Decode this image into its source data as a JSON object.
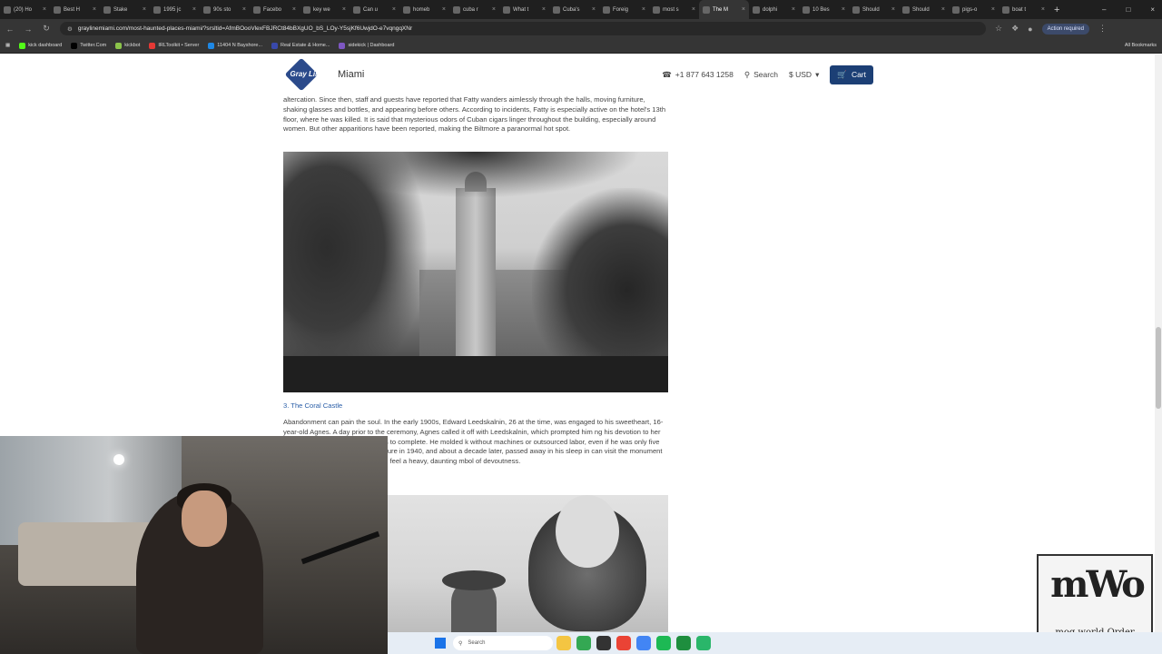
{
  "browser": {
    "tabs": [
      {
        "title": "(20) Ho",
        "active": false
      },
      {
        "title": "Best H",
        "active": false
      },
      {
        "title": "Stake",
        "active": false
      },
      {
        "title": "1995 jc",
        "active": false
      },
      {
        "title": "90s sto",
        "active": false
      },
      {
        "title": "Facebo",
        "active": false
      },
      {
        "title": "key we",
        "active": false
      },
      {
        "title": "Can u",
        "active": false
      },
      {
        "title": "homeb",
        "active": false
      },
      {
        "title": "cuba r",
        "active": false
      },
      {
        "title": "What t",
        "active": false
      },
      {
        "title": "Cuba's",
        "active": false
      },
      {
        "title": "Foreig",
        "active": false
      },
      {
        "title": "most s",
        "active": false
      },
      {
        "title": "The M",
        "active": true
      },
      {
        "title": "dolphi",
        "active": false
      },
      {
        "title": "10 Bes",
        "active": false
      },
      {
        "title": "Should",
        "active": false
      },
      {
        "title": "Should",
        "active": false
      },
      {
        "title": "pigs-o",
        "active": false
      },
      {
        "title": "boat t",
        "active": false
      }
    ],
    "url": "graylinemiami.com/most-haunted-places-miami/?srsltid=AfmBOooVlexFBJRCt84bBXgUO_bS_LOy-Y5sjKf6UwjdO-e7vqngqXNr",
    "action_required": "Action required",
    "bookmarks": [
      {
        "label": "kick dashboard",
        "color": "#53fc18"
      },
      {
        "label": "Twitter.Com",
        "color": "#000000"
      },
      {
        "label": "kickbot",
        "color": "#8bc34a"
      },
      {
        "label": "IRLToolkit • Server",
        "color": "#e53935"
      },
      {
        "label": "11404 N Bayshore...",
        "color": "#1e88e5"
      },
      {
        "label": "Real Estate & Home...",
        "color": "#3949ab"
      },
      {
        "label": "sidekick | Dashboard",
        "color": "#7e57c2"
      }
    ],
    "all_bookmarks": "All Bookmarks"
  },
  "site": {
    "logo_text": "Gray Line",
    "city": "Miami",
    "phone": "+1 877 643 1258",
    "search_label": "Search",
    "currency": "$ USD",
    "cart_label": "Cart"
  },
  "article": {
    "paragraph1": "altercation. Since then, staff and guests have reported that Fatty wanders aimlessly through the halls, moving furniture, shaking glasses and bottles, and appearing before others. According to incidents, Fatty is especially active on the hotel's 13th floor, where he was killed. It is said that mysterious odors of Cuban cigars linger throughout the building, especially around women. But other apparitions have been reported, making the Biltmore a paranormal hot spot.",
    "section_title": "3. The Coral Castle",
    "paragraph2": "Abandonment can pain the soul. In the early 1900s, Edward Leedskalnin, 26 at the time, was engaged to his sweetheart, 16-year-old Agnes. A day prior to the ceremony, Agnes called it off with Leedskalnin, which prompted him ng his devotion to her — a project that took him 28 years to complete. He molded k without machines or outsourced labor, even if he was only five feet tall and weighed ed the sculpture in 1940, and about a decade later, passed away in his sleep in can visit the monument in Coral Castle, and perhaps you'll feel a heavy, daunting mbol of devoutness."
  },
  "watermark": {
    "main": "mWo",
    "sub": "mog world Order"
  },
  "taskbar": {
    "search_placeholder": "Search"
  }
}
